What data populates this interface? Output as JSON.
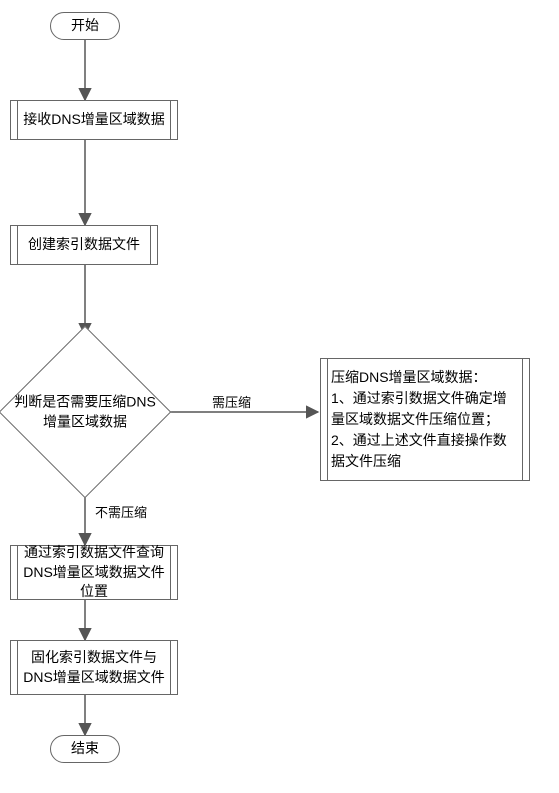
{
  "chart_data": {
    "type": "diagram",
    "title": "",
    "nodes": [
      {
        "id": "n1",
        "type": "terminator",
        "text": "开始"
      },
      {
        "id": "n2",
        "type": "process",
        "text": "接收DNS增量区域数据"
      },
      {
        "id": "n3",
        "type": "process",
        "text": "创建索引数据文件"
      },
      {
        "id": "n4",
        "type": "decision",
        "text": "判断是否需要压缩DNS增量区域数据"
      },
      {
        "id": "n5",
        "type": "process",
        "text": "压缩DNS增量区域数据：\n1、通过索引数据文件确定增量区域数据文件压缩位置；\n2、通过上述文件直接操作数据文件压缩"
      },
      {
        "id": "n6",
        "type": "process",
        "text": "通过索引数据文件查询DNS增量区域数据文件位置"
      },
      {
        "id": "n7",
        "type": "process",
        "text": "固化索引数据文件与DNS增量区域数据文件"
      },
      {
        "id": "n8",
        "type": "terminator",
        "text": "结束"
      }
    ],
    "edges": [
      {
        "from": "n1",
        "to": "n2",
        "label": ""
      },
      {
        "from": "n2",
        "to": "n3",
        "label": ""
      },
      {
        "from": "n3",
        "to": "n4",
        "label": ""
      },
      {
        "from": "n4",
        "to": "n5",
        "label": "需压缩"
      },
      {
        "from": "n4",
        "to": "n6",
        "label": "不需压缩"
      },
      {
        "from": "n6",
        "to": "n7",
        "label": ""
      },
      {
        "from": "n7",
        "to": "n8",
        "label": ""
      }
    ]
  },
  "start": {
    "label": "开始"
  },
  "end": {
    "label": "结束"
  },
  "p1": {
    "text": "接收DNS增量区域数据"
  },
  "p2": {
    "text": "创建索引数据文件"
  },
  "decision": {
    "text": "判断是否需要压缩DNS增量区域数据"
  },
  "side": {
    "line1": "压缩DNS增量区域数据：",
    "line2": "1、通过索引数据文件确定增量区域数据文件压缩位置；",
    "line3": "2、通过上述文件直接操作数据文件压缩"
  },
  "p3": {
    "text": "通过索引数据文件查询DNS增量区域数据文件位置"
  },
  "p4": {
    "text": "固化索引数据文件与DNS增量区域数据文件"
  },
  "edge_yes": {
    "label": "需压缩"
  },
  "edge_no": {
    "label": "不需压缩"
  }
}
